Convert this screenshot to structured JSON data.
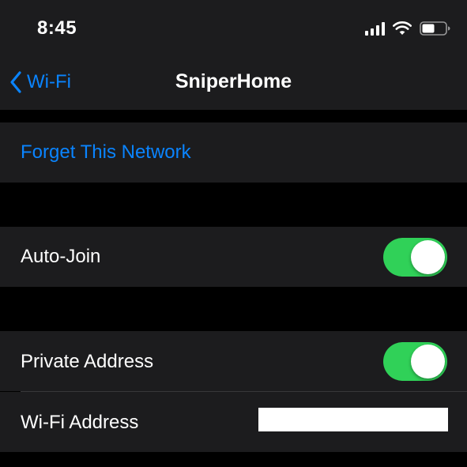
{
  "status_bar": {
    "time": "8:45",
    "icons": [
      "cellular-signal-icon",
      "wifi-icon",
      "battery-icon"
    ]
  },
  "nav": {
    "back_label": "Wi-Fi",
    "title": "SniperHome"
  },
  "sections": {
    "forget": {
      "label": "Forget This Network"
    },
    "auto_join": {
      "label": "Auto-Join",
      "enabled": true
    },
    "privacy": {
      "private_address_label": "Private Address",
      "private_address_enabled": true,
      "wifi_address_label": "Wi-Fi Address"
    }
  },
  "colors": {
    "accent": "#0a84ff",
    "toggle_on": "#30d158",
    "cell_background": "#1c1c1e",
    "grouped_background": "#000000",
    "separator": "#38383a"
  }
}
